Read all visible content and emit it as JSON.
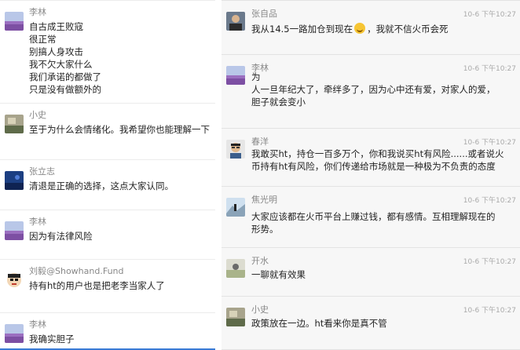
{
  "left_messages": [
    {
      "name": "李林",
      "avatar": "lavender-field-avatar",
      "lines": [
        "自古成王败寇",
        "很正常",
        "别搞人身攻击",
        "我不欠大家什么",
        "我们承诺的都做了",
        "只是没有做额外的"
      ]
    },
    {
      "name": "小史",
      "avatar": "landscape-avatar",
      "lines": [
        "至于为什么会情绪化。我希望你也能理解一下"
      ]
    },
    {
      "name": "张立志",
      "avatar": "blue-night-avatar",
      "lines": [
        "清退是正确的选择，这点大家认同。"
      ]
    },
    {
      "name": "李林",
      "avatar": "lavender-field-avatar",
      "lines": [
        "因为有法律风险"
      ]
    },
    {
      "name": "刘毅@Showhand.Fund",
      "avatar": "cartoon-avatar",
      "lines": [
        "持有ht的用户也是把老李当家人了"
      ]
    },
    {
      "name": "李林",
      "avatar": "lavender-field-avatar",
      "lines": [
        "我确实胆子"
      ]
    }
  ],
  "right_messages": [
    {
      "name": "张自品",
      "time": "10-6 下午10:27",
      "avatar": "portrait-avatar",
      "lines": [
        "我从14.5一路加仓到现在{emoji}，我就不信火币会死"
      ]
    },
    {
      "name": "李林",
      "time": "10-6 下午10:27",
      "avatar": "lavender-field-avatar",
      "lines": [
        "为",
        "人一旦年纪大了，牵绊多了，因为心中还有爱，对家人的爱，",
        "胆子就会变小"
      ]
    },
    {
      "name": "春洋",
      "time": "10-6 下午10:27",
      "avatar": "man-glasses-avatar",
      "lines": [
        "我敢买ht，持仓一百多万个，你和我说买ht有风险......或者说火",
        "币持有ht有风险，你们传递给市场就是一种极为不负责的态度"
      ]
    },
    {
      "name": "焦光明",
      "time": "10-6 下午10:27",
      "avatar": "mountain-person-avatar",
      "lines": [
        "大家应该都在火币平台上赚过钱，都有感情。互相理解现在的",
        "形势。"
      ]
    },
    {
      "name": "开水",
      "time": "10-6 下午10:27",
      "avatar": "outdoor-avatar",
      "lines": [
        "一聊就有效果"
      ]
    },
    {
      "name": "小史",
      "time": "10-6 下午10:27",
      "avatar": "landscape-avatar",
      "lines": [
        "政策放在一边。ht看来你是真不管"
      ]
    }
  ]
}
